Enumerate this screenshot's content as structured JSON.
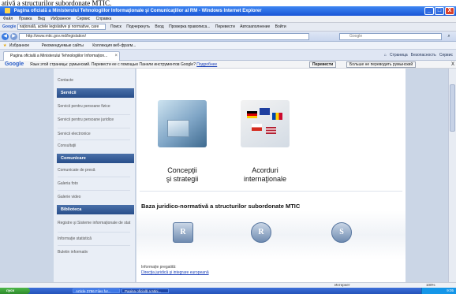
{
  "caption": "ativă a structurilor subordonate MTIC.",
  "window": {
    "title": "Pagina oficială a Ministerului Tehnologiilor Informaţionale şi Comunicaţiilor al RM - Windows Internet Explorer",
    "min": "_",
    "max": "□",
    "close": "X"
  },
  "menu": [
    "Файл",
    "Правка",
    "Вид",
    "Избранное",
    "Сервис",
    "Справка"
  ],
  "google_toolbar": {
    "label": "Google",
    "query": "naţională, actele legislative şi normative, care",
    "items": [
      "Поиск",
      "Подчеркнуть",
      "Вход",
      "Проверка правописа...",
      "Перевести",
      "Автозаполнение",
      "Войти"
    ]
  },
  "address": {
    "url": "http://www.mtic.gov.md/legislation/",
    "search_placeholder": "Google",
    "back": "◀",
    "forward": "▶"
  },
  "favorites": {
    "label": "Избранное",
    "items": [
      "Рекомендуемые сайты",
      "Коллекция веб-фрагм..."
    ]
  },
  "tab": {
    "title": "Pagina oficială a Ministerului Tehnologiilor Informaţion...",
    "right_tools": [
      "Страница",
      "Безопасность",
      "Сервис"
    ]
  },
  "translate": {
    "message": "Язык этой страницы: румынский. Перевести ее с помощью Панели инструментов Google?",
    "link": "Подробнее",
    "primary": "Перевести",
    "secondary": "Больше не переводить румынский",
    "close": "X"
  },
  "sidebar": {
    "top_items": [
      "Contacte"
    ],
    "sections": [
      {
        "title": "Servicii",
        "items": [
          "Servicii pentru persoane fizice",
          "Servicii pentru persoane juridice",
          "Servicii electronice",
          "Consultaţii"
        ]
      },
      {
        "title": "Comunicare",
        "items": [
          "Comunicate de presă",
          "Galeria foto",
          "Galerie video"
        ]
      },
      {
        "title": "Biblioteca",
        "items": [
          "Registre şi Sisteme informaţionale de stat",
          "Informaţie statistică",
          "Buletin informativ"
        ]
      }
    ]
  },
  "main": {
    "tiles": [
      {
        "label_line1": "Concepţii",
        "label_line2": "şi strategii"
      },
      {
        "label_line1": "Acorduri",
        "label_line2": "internaţionale"
      }
    ],
    "heading": "Baza juridico-normativă a structurilor subordonate MTIC",
    "logos": [
      "R",
      "R",
      "S"
    ],
    "info_label": "Informaţie pregatită:",
    "info_link": "Direcţia juridică şi integrare europeană"
  },
  "status": {
    "zone": "Интернет",
    "zoom": "100%"
  },
  "taskbar": {
    "start": "пуск",
    "tasks": [
      "Article 3796 Files for...",
      "Pagina oficială a Mini..."
    ],
    "clock": "9:05"
  },
  "colors": {
    "title": "#1a56d6",
    "sidebar_head": "#284e8a",
    "link": "#1a3fb8"
  }
}
